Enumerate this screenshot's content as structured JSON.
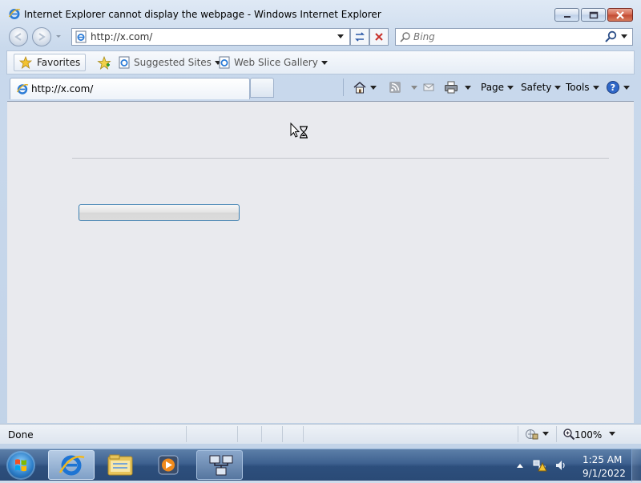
{
  "window": {
    "title": "Internet Explorer cannot display the webpage - Windows Internet Explorer"
  },
  "nav": {
    "address_value": "http://x.com/",
    "search_placeholder": "Bing"
  },
  "favorites_bar": {
    "favorites_label": "Favorites",
    "items": [
      {
        "label": "Suggested Sites",
        "icon": "ie-page-icon"
      },
      {
        "label": "Web Slice Gallery",
        "icon": "ie-page-icon"
      }
    ]
  },
  "tabs": [
    {
      "label": "http://x.com/",
      "active": true
    }
  ],
  "command_bar": {
    "page_label": "Page",
    "safety_label": "Safety",
    "tools_label": "Tools"
  },
  "status_bar": {
    "status_text": "Done",
    "zoom": "100%"
  },
  "taskbar": {
    "apps": [
      "internet-explorer",
      "windows-explorer",
      "media-player",
      "network"
    ],
    "clock_time": "1:25 AM",
    "clock_date": "9/1/2022"
  },
  "colors": {
    "window_frame": "#c9d9ec",
    "content_bg": "#e9eaee",
    "taskbar": "#3e6190",
    "close_button": "#c24a32"
  }
}
